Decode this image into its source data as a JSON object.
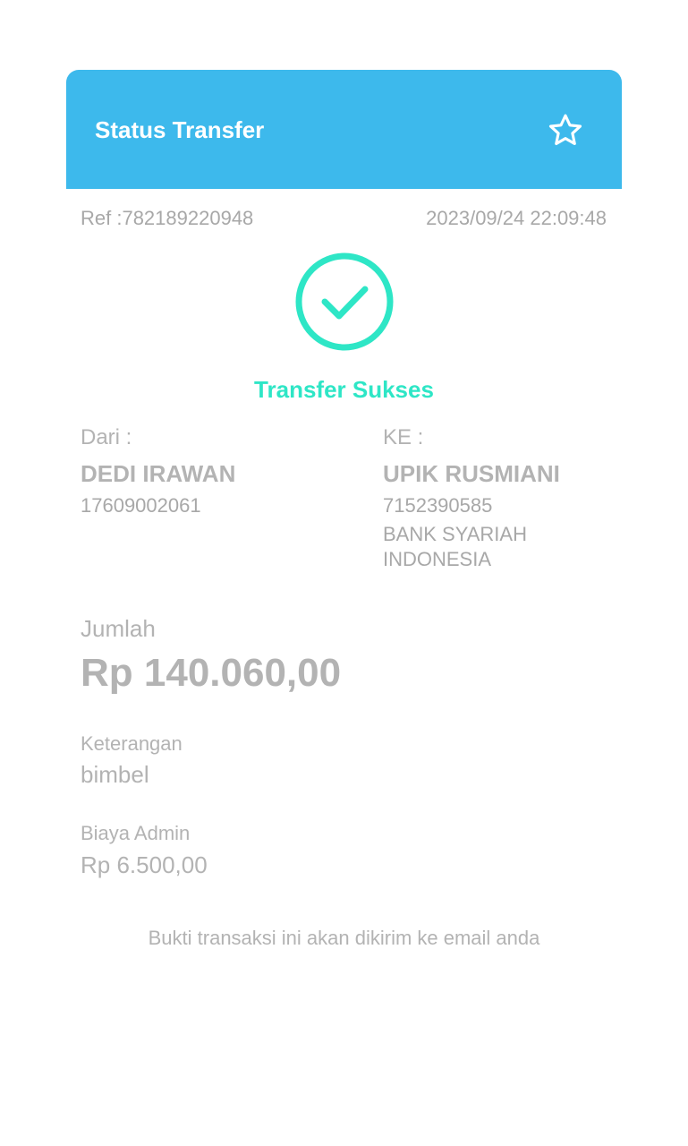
{
  "header": {
    "title": "Status Transfer",
    "favorite_icon": "star-outline-icon",
    "background_color": "#3db9ec"
  },
  "transaction": {
    "ref": "Ref :782189220948",
    "datetime": "2023/09/24 22:09:48",
    "status_icon": "check-circle-icon",
    "status": "Transfer Sukses",
    "status_color": "#2ee6c6"
  },
  "from": {
    "label": "Dari :",
    "name": "DEDI IRAWAN",
    "account": "17609002061"
  },
  "to": {
    "label": "KE :",
    "name": "UPIK RUSMIANI",
    "account": "7152390585",
    "bank": "BANK SYARIAH INDONESIA"
  },
  "amount": {
    "label": "Jumlah",
    "value": "Rp 140.060,00"
  },
  "note": {
    "label": "Keterangan",
    "value": "bimbel"
  },
  "admin_fee": {
    "label": "Biaya Admin",
    "value": "Rp 6.500,00"
  },
  "footer": {
    "note": "Bukti transaksi ini akan dikirim ke email anda"
  }
}
